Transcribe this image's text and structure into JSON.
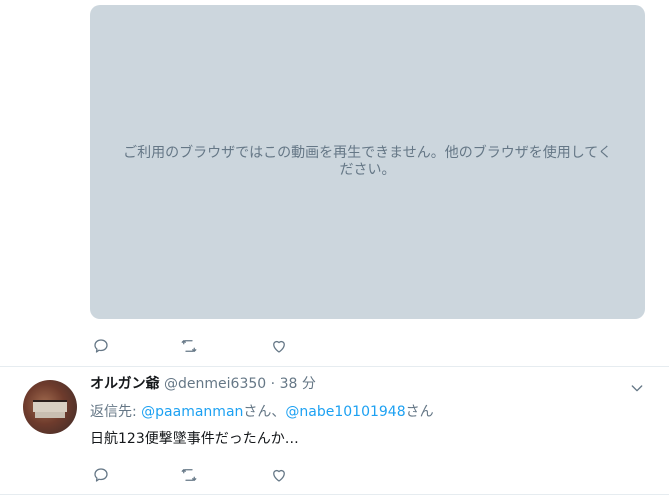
{
  "video": {
    "message": "ご利用のブラウザではこの動画を再生できません。他のブラウザを使用してください。"
  },
  "tweet": {
    "display_name": "オルガン爺",
    "handle": "@denmei6350",
    "separator": "·",
    "time": "38 分",
    "reply_prefix": "返信先: ",
    "mention_1": "@paamanman",
    "suffix_1": "さん、",
    "mention_2": "@nabe10101948",
    "suffix_2": "さん",
    "text": "日航123便撃墜事件だったんか…"
  },
  "icons": {
    "reply": "reply-icon",
    "retweet": "retweet-icon",
    "like": "like-icon",
    "menu": "chevron-down-icon"
  }
}
